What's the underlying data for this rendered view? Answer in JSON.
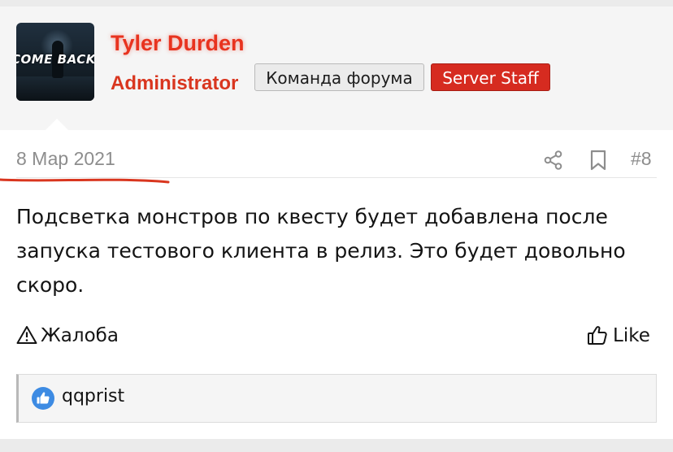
{
  "user": {
    "name": "Tyler Durden",
    "title": "Administrator",
    "avatar_text": "COME BACK",
    "badges": [
      "Команда форума",
      "Server Staff"
    ]
  },
  "post": {
    "date": "8 Мар 2021",
    "number": "#8",
    "body": "Подсветка монстров по квесту будет добавлена после запуска тестового клиента в релиз. Это будет довольно скоро."
  },
  "actions": {
    "report_label": "Жалоба",
    "like_label": "Like"
  },
  "reactions": {
    "users": [
      "qqprist"
    ]
  },
  "icons": {
    "share": "share-icon",
    "bookmark": "bookmark-icon",
    "report": "warning-triangle-icon",
    "like": "thumbs-up-icon",
    "reaction": "thumbs-up-reaction-icon"
  },
  "colors": {
    "username": "#e8331f",
    "title": "#d9361f",
    "staff_badge": "#d62b20",
    "reaction_blue": "#3d8be3",
    "meta_gray": "#8d8d8d"
  }
}
